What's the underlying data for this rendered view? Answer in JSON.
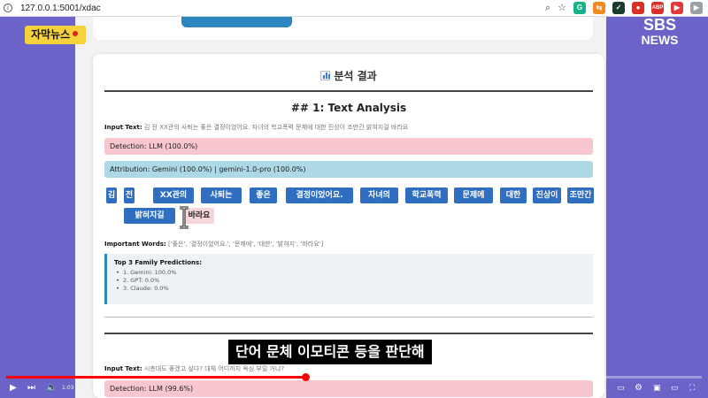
{
  "browser": {
    "url": "127.0.0.1:5001/xdac",
    "extensions": [
      {
        "name": "grammarly-icon",
        "label": "G",
        "color": "#15b386"
      },
      {
        "name": "translate-ext-icon",
        "label": "⇆",
        "color": "#f08a24"
      },
      {
        "name": "dev-ext-icon",
        "label": "✓",
        "color": "#1b3b2c"
      },
      {
        "name": "pin-ext-icon",
        "label": "●",
        "color": "#d93025"
      },
      {
        "name": "adblock-icon",
        "label": "ABP",
        "color": "#d93025"
      },
      {
        "name": "record-ext-icon",
        "label": "▶",
        "color": "#e23b3b"
      },
      {
        "name": "player-ext-icon",
        "label": "▶",
        "color": "#9aa0a6"
      }
    ]
  },
  "overlays": {
    "badge": "자막뉴스",
    "brand_line1": "SBS",
    "brand_line2": "NEWS",
    "subtitle": "단어 문체 이모티콘 등을 판단해"
  },
  "card": {
    "title": "분석 결과",
    "analysis_title": "## 1: Text Analysis",
    "input_label": "Input Text:",
    "input_value": "김 전 XX관의 사퇴는 좋은 결정이었어요. 자녀의 학교폭력 문제에 대한 진상이 조만간 밝혀지길 바라요",
    "detection": "Detection: LLM (100.0%)",
    "attribution": "Attribution: Gemini (100.0%) | gemini-1.0-pro (100.0%)",
    "tokens": [
      {
        "text": "김",
        "highlight": true
      },
      {
        "text": "전",
        "highlight": true
      },
      {
        "text": "XX관의",
        "highlight": true
      },
      {
        "text": "사퇴는",
        "highlight": true
      },
      {
        "text": "좋은",
        "highlight": true
      },
      {
        "text": "결정이었어요.",
        "highlight": true
      },
      {
        "text": "자녀의",
        "highlight": true
      },
      {
        "text": "학교폭력",
        "highlight": true
      },
      {
        "text": "문제에",
        "highlight": true
      },
      {
        "text": "대한",
        "highlight": true
      },
      {
        "text": "진상이",
        "highlight": true
      },
      {
        "text": "조만간",
        "highlight": true
      },
      {
        "text": "밝혀지길",
        "highlight": true
      },
      {
        "text": "바라요",
        "highlight": false
      }
    ],
    "important_label": "Important Words:",
    "important_value": "['좋은', '결정이었어요.', '문제에', '대한', '밝혀지', '바라요']",
    "predictions_title": "Top 3 Family Predictions:",
    "predictions": [
      "1. Gemini: 100.0%",
      "2. GPT: 0.0%",
      "3. Claude: 0.0%"
    ],
    "input2_label": "Input Text:",
    "input2_value": "시총대도 좋겠고 싶다? 대체 어디까지 욕심 부릴 거냐?",
    "detection2": "Detection: LLM (99.6%)"
  },
  "player": {
    "time": "1:03 / 2:21",
    "progress": 0.43
  }
}
